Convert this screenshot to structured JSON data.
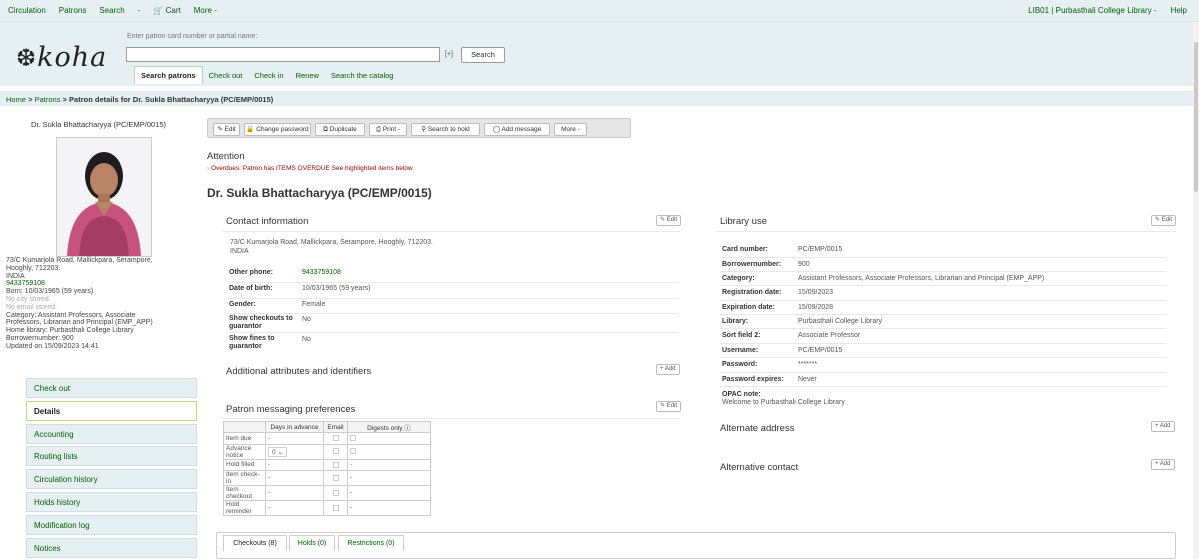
{
  "topnav": {
    "items": [
      "Circulation",
      "Patrons",
      "Search",
      "-",
      "Cart",
      "More -"
    ],
    "library": "LIB01 | Purbasthali College Library -",
    "help": "Help"
  },
  "header": {
    "logo": "koha",
    "hint": "Enter patron card number or partial name:",
    "plus": "[+]",
    "search_button": "Search",
    "tabs": [
      "Search patrons",
      "Check out",
      "Check in",
      "Renew",
      "Search the catalog"
    ]
  },
  "breadcrumb": {
    "home": "Home",
    "sep": ">",
    "patrons": "Patrons",
    "current": "Patron details for Dr. Sukla Bhattacharyya (PC/EMP/0015)"
  },
  "sidebar": {
    "name": "Dr. Sukla Bhattacharyya (PC/EMP/0015)",
    "info": [
      "73/C Kumarjola Road, Mallickpara, Serampore,",
      "Hooghly, 712203.",
      "INDIA",
      "9433759108",
      "Born: 10/03/1965 (59 years)",
      "No city stored.",
      "No email stored.",
      "Category: Assistant Professors, Associate",
      "Professors, Librarian and Principal (EMP_APP)",
      "Home library: Purbasthali College Library",
      "Borrowernumber: 900",
      "Updated on 15/09/2023 14:41"
    ],
    "menu": [
      "Check out",
      "Details",
      "Accounting",
      "Routing lists",
      "Circulation history",
      "Holds history",
      "Modification log",
      "Notices"
    ]
  },
  "toolbar": [
    "Edit",
    "Change password",
    "Duplicate",
    "Print -",
    "Search to hold",
    "Add message",
    "More -"
  ],
  "attention": {
    "title": "Attention",
    "item": "Overdues: Patron has ITEMS OVERDUE See highlighted items below"
  },
  "patron_title": "Dr. Sukla Bhattacharyya (PC/EMP/0015)",
  "contact": {
    "heading": "Contact information",
    "edit": "Edit",
    "address1": "73/C Kumarjola Road, Mallickpara, Serampore, Hooghly, 712203.",
    "address2": "INDIA",
    "rows": [
      {
        "k": "Other phone:",
        "v": "9433759108"
      },
      {
        "k": "Date of birth:",
        "v": "10/03/1965 (59 years)"
      },
      {
        "k": "Gender:",
        "v": "Female"
      },
      {
        "k": "Show checkouts to guarantor",
        "v": "No"
      },
      {
        "k": "Show fines to guarantor",
        "v": "No"
      }
    ]
  },
  "additional": {
    "heading": "Additional attributes and identifiers",
    "add": "Add"
  },
  "messaging": {
    "heading": "Patron messaging preferences",
    "edit": "Edit",
    "cols": [
      "",
      "Days in advance",
      "Email",
      "Digests only"
    ],
    "rows": [
      {
        "label": "Item due",
        "days": "-",
        "digest": ""
      },
      {
        "label": "Advance notice",
        "days": "0",
        "digest": ""
      },
      {
        "label": "Hold filled",
        "days": "-",
        "digest": "-"
      },
      {
        "label": "Item check-in",
        "days": "-",
        "digest": "-"
      },
      {
        "label": "Item checkout",
        "days": "-",
        "digest": "-"
      },
      {
        "label": "Hold reminder",
        "days": "-",
        "digest": "-"
      }
    ]
  },
  "library_use": {
    "heading": "Library use",
    "edit": "Edit",
    "rows": [
      {
        "k": "Card number:",
        "v": "PC/EMP/0015"
      },
      {
        "k": "Borrowernumber:",
        "v": "900"
      },
      {
        "k": "Category:",
        "v": "Assistant Professors, Associate Professors, Librarian and Principal (EMP_APP)"
      },
      {
        "k": "Registration date:",
        "v": "15/09/2023"
      },
      {
        "k": "Expiration date:",
        "v": "15/09/2028"
      },
      {
        "k": "Library:",
        "v": "Purbasthali College Library"
      },
      {
        "k": "Sort field 2:",
        "v": "Associate Professor"
      },
      {
        "k": "Username:",
        "v": "PC/EMP/0015"
      },
      {
        "k": "Password:",
        "v": "*******"
      },
      {
        "k": "Password expires:",
        "v": "Never"
      }
    ],
    "opac_label": "OPAC note:",
    "opac_value": "Welcome to Purbasthali College Library"
  },
  "alt_address": {
    "heading": "Alternate address",
    "add": "Add"
  },
  "alt_contact": {
    "heading": "Alternative contact",
    "add": "Add"
  },
  "bottom_tabs": [
    "Checkouts (8)",
    "Holds (0)",
    "Restrictions (0)"
  ]
}
